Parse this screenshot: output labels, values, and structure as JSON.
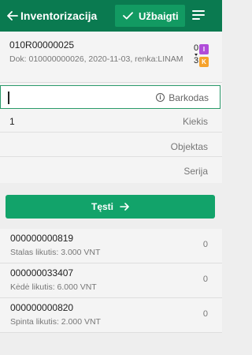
{
  "header": {
    "title": "Inventorizacija",
    "finish_label": "Užbaigti"
  },
  "document": {
    "code": "010R00000025",
    "info": "Dok: 010000000026, 2020-11-03, renka:LINAM",
    "counter_top": "0",
    "counter_bottom": "3",
    "badge_i": "I",
    "badge_k": "K"
  },
  "form": {
    "barcode_label": "Barkodas",
    "barcode_value": "",
    "quantity_value": "1",
    "quantity_label": "Kiekis",
    "object_label": "Objektas",
    "series_label": "Serija"
  },
  "continue_label": "Tęsti",
  "items": [
    {
      "code": "000000000819",
      "sub": "Stalas likutis: 3.000 VNT",
      "count": "0"
    },
    {
      "code": "000000033407",
      "sub": "Kėdė likutis: 6.000 VNT",
      "count": "0"
    },
    {
      "code": "000000000820",
      "sub": "Spinta likutis: 2.000 VNT",
      "count": "0"
    }
  ],
  "colors": {
    "header_bg": "#0a7a50",
    "accent": "#12a36a",
    "badge_i": "#b04cd9",
    "badge_k": "#f6a22c"
  },
  "icons": [
    "back-arrow-icon",
    "check-icon",
    "menu-icon",
    "info-icon",
    "arrow-right-icon"
  ]
}
